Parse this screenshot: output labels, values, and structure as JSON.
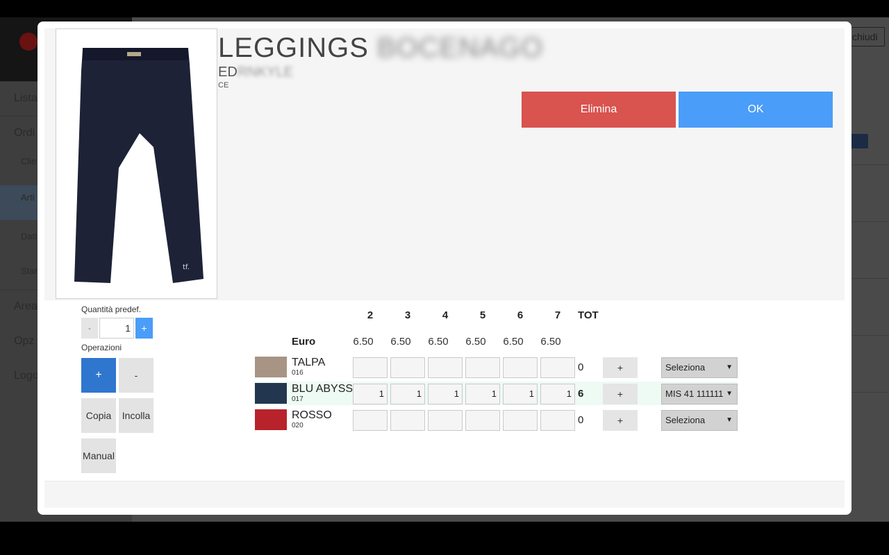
{
  "background": {
    "menu_items": [
      "Lista",
      "Ordi",
      "Area",
      "Opz",
      "Logo"
    ],
    "sub_items": [
      "Clie",
      "Arti",
      "Dati",
      "Stan"
    ],
    "close_label": "chiudi"
  },
  "product": {
    "title": "LEGGINGS",
    "title_blurred": "BOCENAGO",
    "subtitle": "ED",
    "subtitle_blurred": "RNKYLE",
    "subsub": "CE"
  },
  "actions": {
    "delete_label": "Elimina",
    "ok_label": "OK"
  },
  "left_panel": {
    "default_qty_label": "Quantità predef.",
    "qty_minus": "-",
    "qty_value": "1",
    "qty_plus": "+",
    "operations_label": "Operazioni",
    "op_plus": "+",
    "op_minus": "-",
    "copy_label": "Copia",
    "paste_label": "Incolla",
    "manual_label": "Manual"
  },
  "grid": {
    "sizes": [
      "2",
      "3",
      "4",
      "5",
      "6",
      "7"
    ],
    "tot_label": "TOT",
    "price_label": "Euro",
    "prices": [
      "6.50",
      "6.50",
      "6.50",
      "6.50",
      "6.50",
      "6.50"
    ],
    "add_label": "+",
    "rows": [
      {
        "name": "TALPA",
        "code": "016",
        "swatch": "#a89484",
        "qty": [
          "",
          "",
          "",
          "",
          "",
          ""
        ],
        "tot": "0",
        "select": "Seleziona"
      },
      {
        "name": "BLU ABYSS",
        "code": "017",
        "swatch": "#233650",
        "qty": [
          "1",
          "1",
          "1",
          "1",
          "1",
          "1"
        ],
        "tot": "6",
        "select": "MIS 41 111111"
      },
      {
        "name": "ROSSO",
        "code": "020",
        "swatch": "#b8222a",
        "qty": [
          "",
          "",
          "",
          "",
          "",
          ""
        ],
        "tot": "0",
        "select": "Seleziona"
      }
    ]
  },
  "colors": {
    "delete": "#d9534f",
    "ok": "#4a9df8",
    "primary_dark": "#2f76cf"
  }
}
